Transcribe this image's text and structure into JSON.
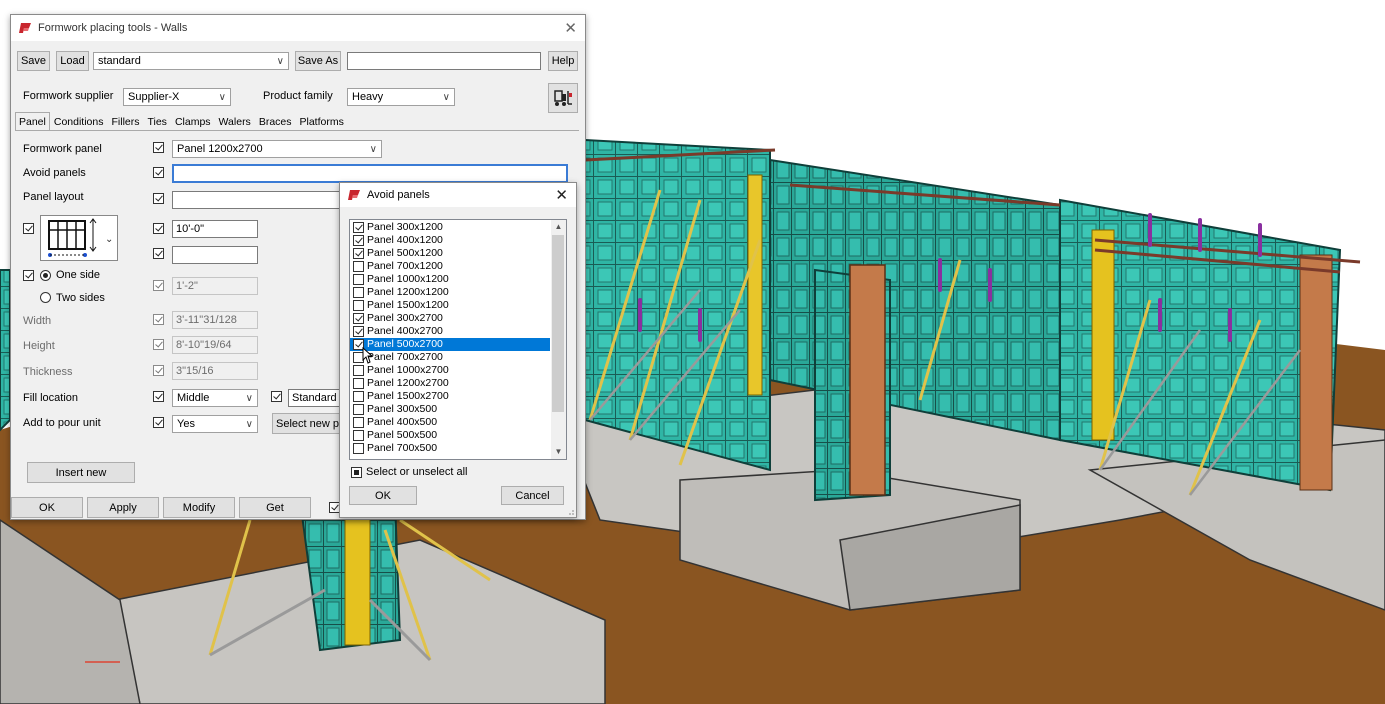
{
  "colors": {
    "accent": "#0078d7",
    "app_icon": "#c8262e"
  },
  "main_dialog": {
    "title": "Formwork placing tools - Walls",
    "toolbar": {
      "save": "Save",
      "load": "Load",
      "preset_value": "standard",
      "save_as": "Save As",
      "save_as_name": "",
      "help": "Help"
    },
    "supplier_label": "Formwork supplier",
    "supplier_value": "Supplier-X",
    "family_label": "Product family",
    "family_value": "Heavy",
    "tabs": [
      "Panel",
      "Conditions",
      "Fillers",
      "Ties",
      "Clamps",
      "Walers",
      "Braces",
      "Platforms"
    ],
    "panel_tab": {
      "formwork_panel_label": "Formwork panel",
      "formwork_panel_value": "Panel 1200x2700",
      "avoid_panels_label": "Avoid panels",
      "avoid_panels_value": "",
      "panel_layout_label": "Panel layout",
      "panel_layout_value": "",
      "dim1_value": "10'-0\"",
      "dim2_value": "",
      "one_side_label": "One side",
      "two_sides_label": "Two sides",
      "one_side_dim": "1'-2\"",
      "width_label": "Width",
      "width_value": "3'-11\"31/128",
      "height_label": "Height",
      "height_value": "8'-10\"19/64",
      "thickness_label": "Thickness",
      "thickness_value": "3\"15/16",
      "fill_location_label": "Fill location",
      "fill_location_value": "Middle",
      "standard_value": "Standard ti",
      "pour_unit_label": "Add to pour unit",
      "pour_unit_value": "Yes",
      "select_new_label": "Select new p",
      "insert_new": "Insert new"
    },
    "footer": {
      "ok": "OK",
      "apply": "Apply",
      "modify": "Modify",
      "get": "Get"
    }
  },
  "avoid_dialog": {
    "title": "Avoid panels",
    "items": [
      {
        "label": "Panel 300x1200",
        "checked": true
      },
      {
        "label": "Panel 400x1200",
        "checked": true
      },
      {
        "label": "Panel 500x1200",
        "checked": true
      },
      {
        "label": "Panel 700x1200",
        "checked": false
      },
      {
        "label": "Panel 1000x1200",
        "checked": false
      },
      {
        "label": "Panel 1200x1200",
        "checked": false
      },
      {
        "label": "Panel 1500x1200",
        "checked": false
      },
      {
        "label": "Panel 300x2700",
        "checked": true
      },
      {
        "label": "Panel 400x2700",
        "checked": true
      },
      {
        "label": "Panel 500x2700",
        "checked": true,
        "selected": true
      },
      {
        "label": "Panel 700x2700",
        "checked": false
      },
      {
        "label": "Panel 1000x2700",
        "checked": false
      },
      {
        "label": "Panel 1200x2700",
        "checked": false
      },
      {
        "label": "Panel 1500x2700",
        "checked": false
      },
      {
        "label": "Panel 300x500",
        "checked": false
      },
      {
        "label": "Panel 400x500",
        "checked": false
      },
      {
        "label": "Panel 500x500",
        "checked": false
      },
      {
        "label": "Panel 700x500",
        "checked": false
      }
    ],
    "select_all_label": "Select or unselect all",
    "ok": "OK",
    "cancel": "Cancel"
  }
}
